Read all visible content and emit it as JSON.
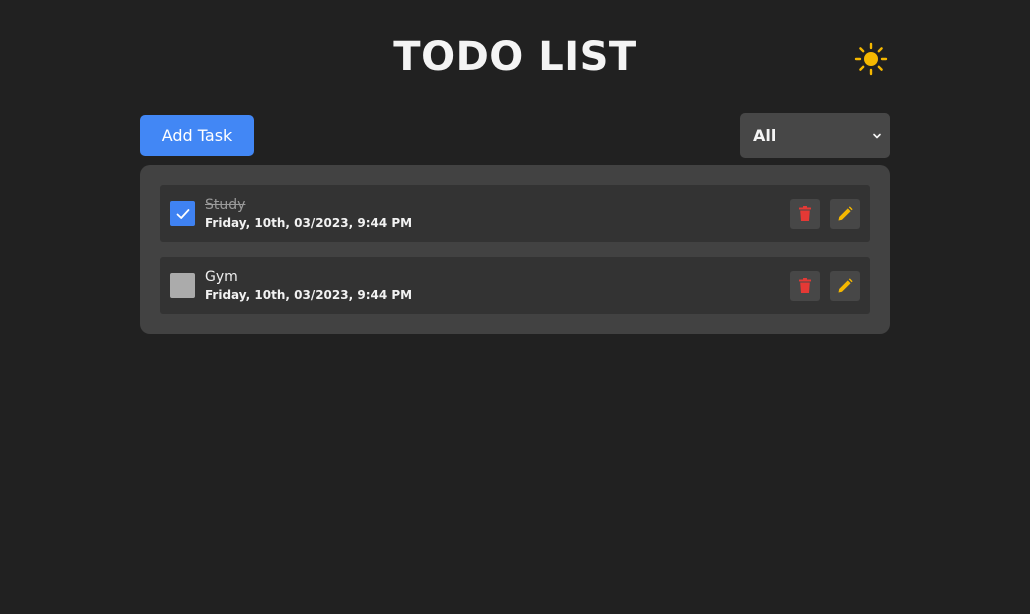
{
  "app": {
    "title": "TODO LIST",
    "theme_icon": "sun-icon"
  },
  "toolbar": {
    "add_label": "Add Task",
    "filter": {
      "selected": "All"
    }
  },
  "tasks": [
    {
      "title": "Study",
      "time": "Friday, 10th, 03/2023, 9:44 PM",
      "completed": true
    },
    {
      "title": "Gym",
      "time": "Friday, 10th, 03/2023, 9:44 PM",
      "completed": false
    }
  ],
  "colors": {
    "background": "#212121",
    "accent": "#4287f5",
    "delete": "#e53935",
    "edit": "#f5b800",
    "sun": "#f5b800"
  }
}
